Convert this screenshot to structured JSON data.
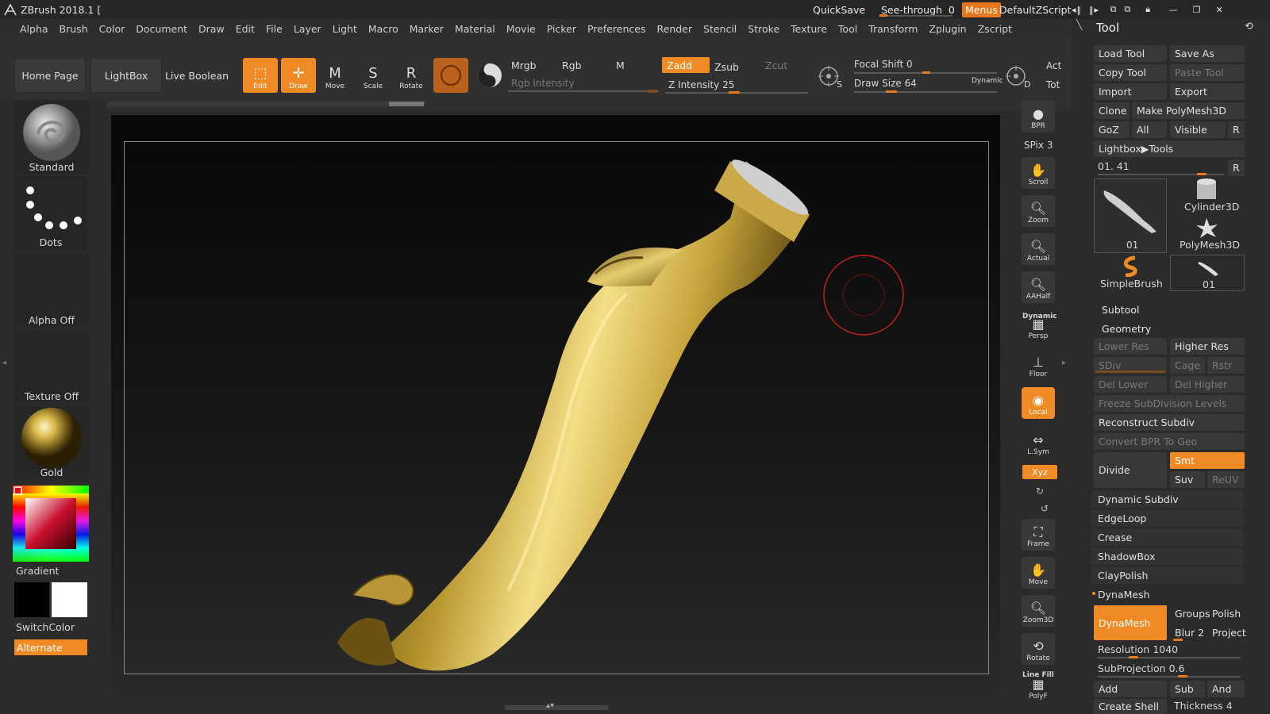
{
  "app": {
    "title": "ZBrush 2018.1 ["
  },
  "titlebar": {
    "quicksave": "QuickSave",
    "see_through_label": "See-through",
    "see_through_value": "0",
    "menus": "Menus",
    "script": "DefaultZScript"
  },
  "menubar": [
    "Alpha",
    "Brush",
    "Color",
    "Document",
    "Draw",
    "Edit",
    "File",
    "Layer",
    "Light",
    "Macro",
    "Marker",
    "Material",
    "Movie",
    "Picker",
    "Preferences",
    "Render",
    "Stencil",
    "Stroke",
    "Texture",
    "Tool",
    "Transform",
    "Zplugin",
    "Zscript"
  ],
  "shelf": {
    "home_page": "Home Page",
    "lightbox": "LightBox",
    "live_boolean": "Live Boolean",
    "tools": [
      {
        "label": "Edit",
        "icon": "edit-icon"
      },
      {
        "label": "Draw",
        "icon": "draw-icon"
      },
      {
        "label": "Move",
        "icon": "move-icon"
      },
      {
        "label": "Scale",
        "icon": "scale-icon"
      },
      {
        "label": "Rotate",
        "icon": "rotate-icon"
      }
    ],
    "mrgb": "Mrgb",
    "rgb": "Rgb",
    "m": "M",
    "zadd": "Zadd",
    "zsub": "Zsub",
    "zcut": "Zcut",
    "rgb_intensity": "Rgb Intensity",
    "z_intensity_label": "Z Intensity",
    "z_intensity_value": "25",
    "focal_shift_label": "Focal Shift",
    "focal_shift_value": "0",
    "draw_size_label": "Draw Size",
    "draw_size_value": "64",
    "dynamic": "Dynamic",
    "act": "Act",
    "tot": "Tot",
    "s_label": "S",
    "d_label": "D"
  },
  "left_panel": {
    "brush": "Standard",
    "stroke": "Dots",
    "alpha": "Alpha Off",
    "texture": "Texture Off",
    "material": "Gold",
    "gradient": "Gradient",
    "switch_color": "SwitchColor",
    "alternate": "Alternate"
  },
  "right_strip": [
    {
      "label": "BPR",
      "icon": "bpr-icon"
    },
    {
      "label": "Scroll",
      "icon": "scroll-icon"
    },
    {
      "label": "Zoom",
      "icon": "zoom-icon"
    },
    {
      "label": "Actual",
      "icon": "actual-icon"
    },
    {
      "label": "AAHalf",
      "icon": "aahalf-icon"
    },
    {
      "label": "Persp",
      "icon": "persp-icon"
    },
    {
      "label": "Floor",
      "icon": "floor-icon"
    },
    {
      "label": "Local",
      "icon": "local-icon"
    },
    {
      "label": "L.Sym",
      "icon": "lsym-icon"
    },
    {
      "label": "Frame",
      "icon": "frame-icon"
    },
    {
      "label": "Move",
      "icon": "move-icon"
    },
    {
      "label": "Zoom3D",
      "icon": "zoom3d-icon"
    },
    {
      "label": "Rotate",
      "icon": "rotate-icon"
    },
    {
      "label": "PolyF",
      "icon": "polyf-icon"
    }
  ],
  "right_strip_extra": {
    "spix": "SPix 3",
    "dynamic": "Dynamic",
    "xyz": "Xyz",
    "line_fill": "Line Fill"
  },
  "tool_palette": {
    "title": "Tool",
    "load_tool": "Load Tool",
    "save_as": "Save As",
    "copy_tool": "Copy Tool",
    "paste_tool": "Paste Tool",
    "import": "Import",
    "export": "Export",
    "clone": "Clone",
    "make_polymesh": "Make PolyMesh3D",
    "goz": "GoZ",
    "all": "All",
    "visible": "Visible",
    "r": "R",
    "lightbox_tools": "Lightbox▶Tools",
    "tool_slider": "01. 41",
    "thumbs": [
      {
        "label": "01",
        "icon": "leg-thumb-icon"
      },
      {
        "label": "Cylinder3D",
        "icon": "cylinder-icon"
      },
      {
        "label": "PolyMesh3D",
        "icon": "star-icon"
      },
      {
        "label": "SimpleBrush",
        "icon": "simplebrush-icon"
      },
      {
        "label": "01",
        "icon": "leg-thumb-icon"
      }
    ],
    "subtool": "Subtool",
    "geometry": "Geometry",
    "lower_res": "Lower Res",
    "higher_res": "Higher Res",
    "sdiv": "SDiv",
    "cage": "Cage",
    "rstr": "Rstr",
    "del_lower": "Del Lower",
    "del_higher": "Del Higher",
    "freeze": "Freeze SubDivision Levels",
    "reconstruct": "Reconstruct Subdiv",
    "convert_bpr": "Convert BPR To Geo",
    "divide": "Divide",
    "smt": "Smt",
    "suv": "Suv",
    "reuv": "ReUV",
    "dynamic_subdiv": "Dynamic Subdiv",
    "edgeloop": "EdgeLoop",
    "crease": "Crease",
    "shadowbox": "ShadowBox",
    "claypolish": "ClayPolish",
    "dynamesh_section": "DynaMesh",
    "dynamesh_btn": "DynaMesh",
    "groups": "Groups",
    "polish": "Polish",
    "blur": "Blur 2",
    "project": "Project",
    "resolution_label": "Resolution",
    "resolution_value": "1040",
    "subprojection_label": "SubProjection",
    "subprojection_value": "0.6",
    "add": "Add",
    "sub": "Sub",
    "and": "And",
    "create_shell": "Create Shell",
    "thickness_label": "Thickness",
    "thickness_value": "4"
  },
  "colors": {
    "accent": "#f08a24",
    "bg": "#2b2b2b",
    "brush_ring": "#c0201c"
  }
}
